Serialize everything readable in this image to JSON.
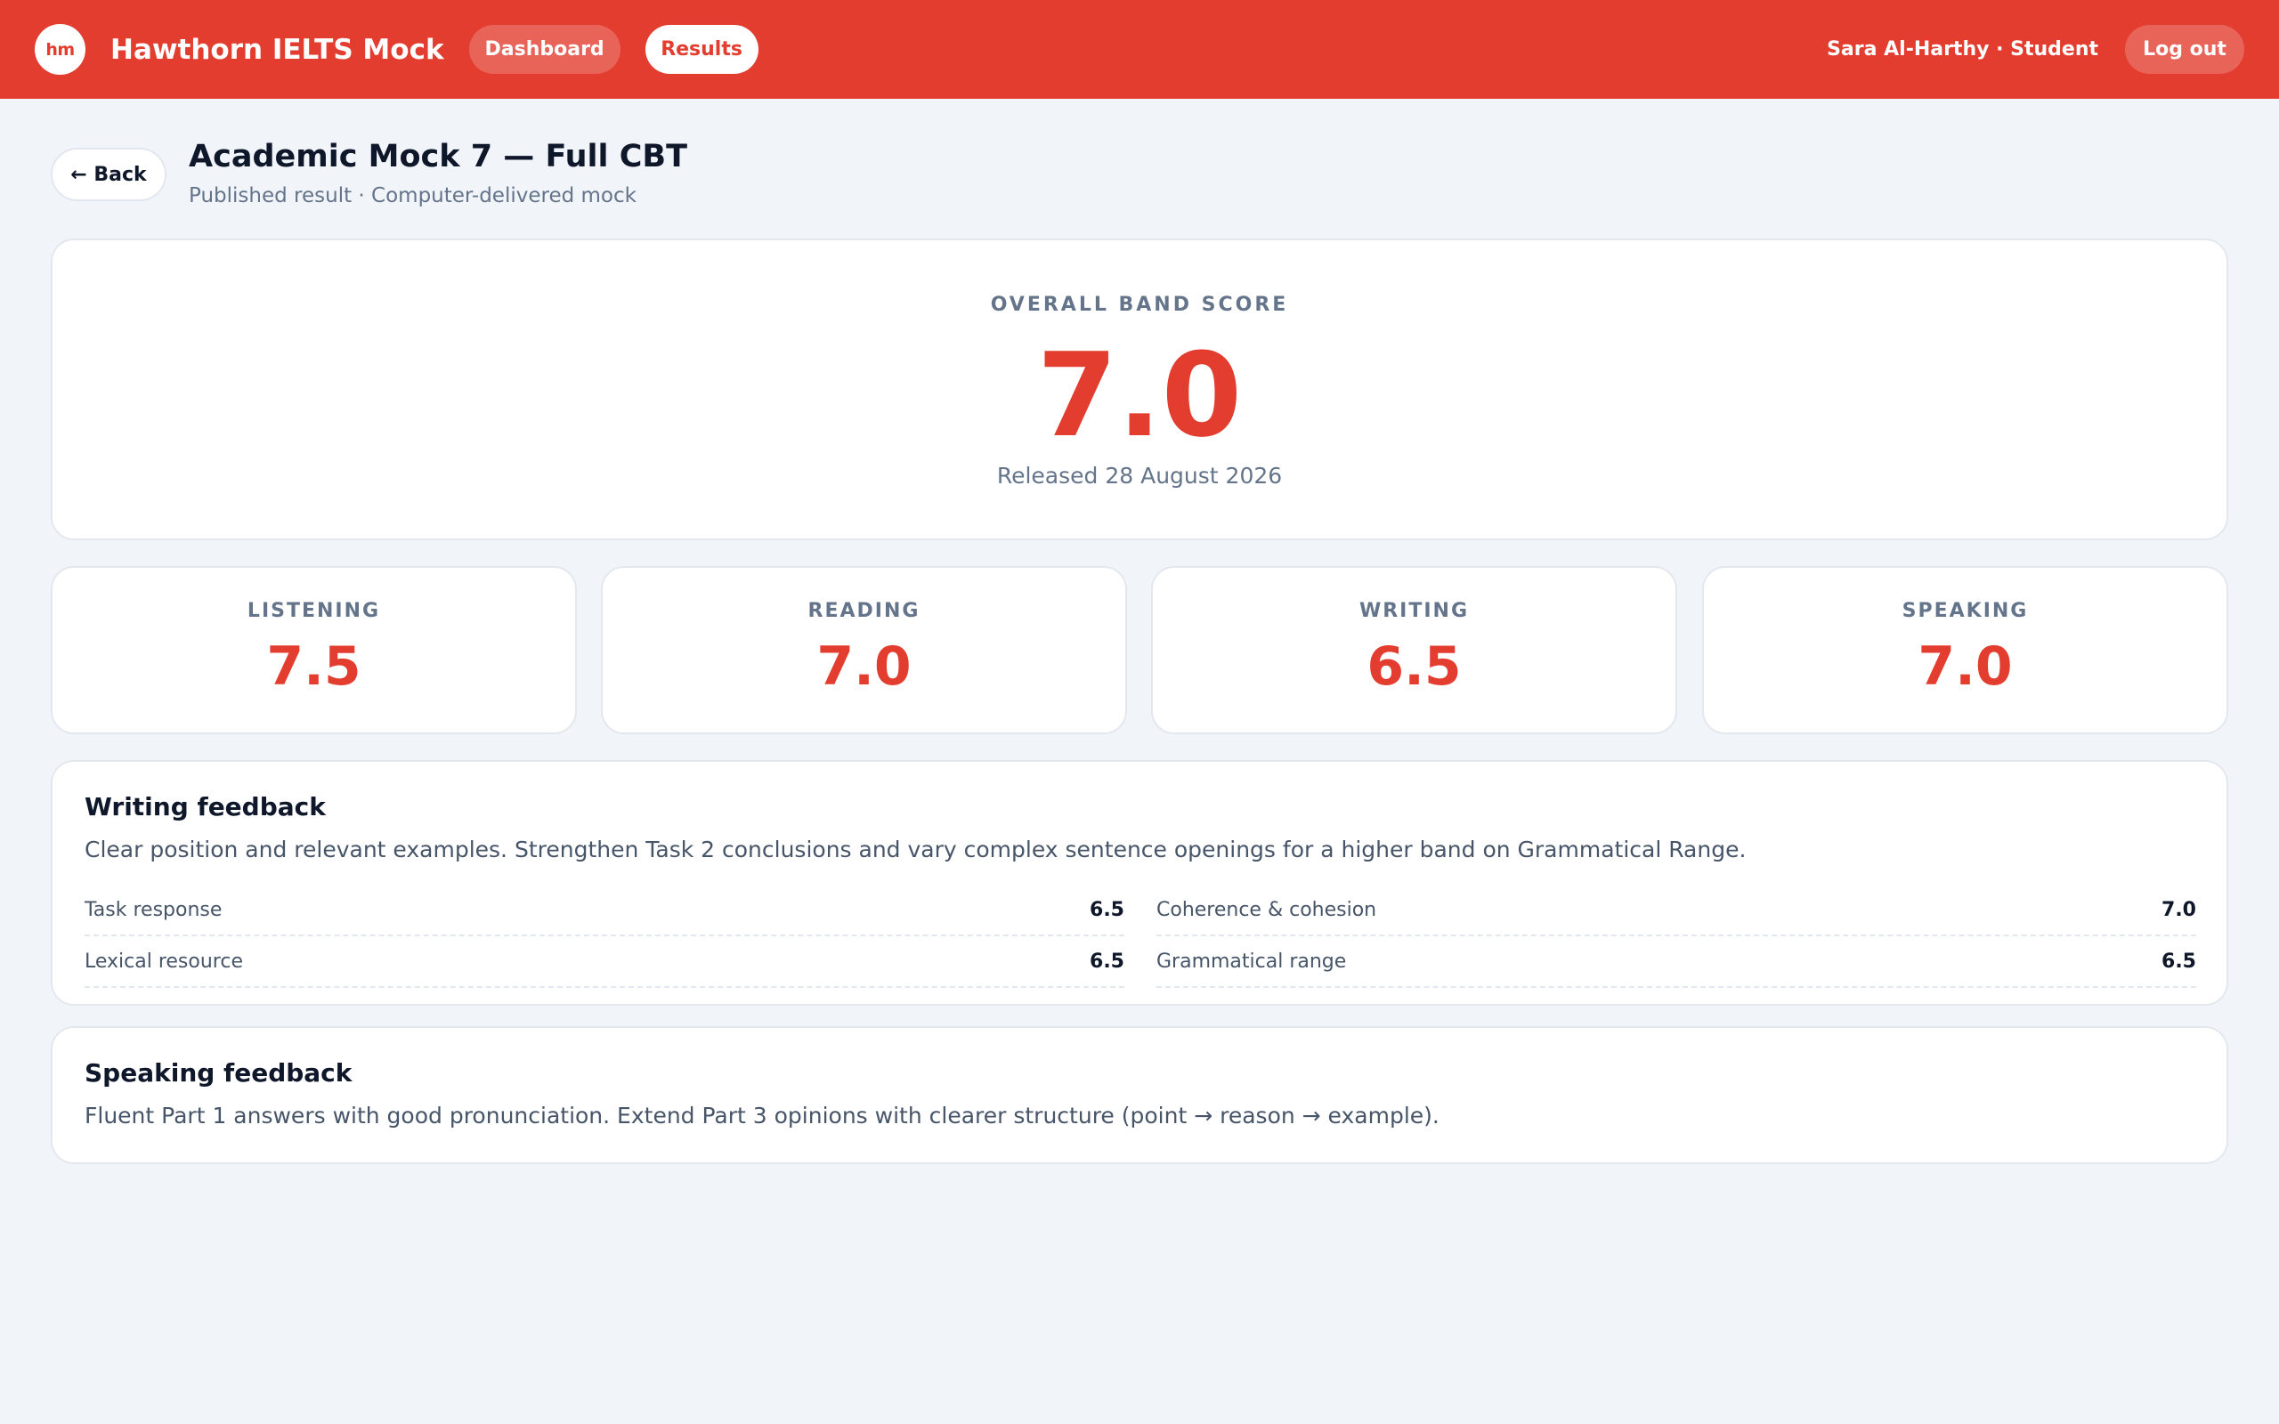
{
  "header": {
    "logo_text": "hm",
    "brand": "Hawthorn IELTS Mock",
    "nav": {
      "dashboard": "Dashboard",
      "results": "Results"
    },
    "user": "Sara Al-Harthy · Student",
    "logout": "Log out"
  },
  "page": {
    "back_label": "← Back",
    "title": "Academic Mock 7 — Full CBT",
    "subtitle": "Published result · Computer-delivered mock"
  },
  "overall": {
    "label": "OVERALL BAND SCORE",
    "score": "7.0",
    "released": "Released 28 August 2026"
  },
  "skills": [
    {
      "name": "LISTENING",
      "score": "7.5"
    },
    {
      "name": "READING",
      "score": "7.0"
    },
    {
      "name": "WRITING",
      "score": "6.5"
    },
    {
      "name": "SPEAKING",
      "score": "7.0"
    }
  ],
  "writing_feedback": {
    "title": "Writing feedback",
    "text": "Clear position and relevant examples. Strengthen Task 2 conclusions and vary complex sentence openings for a higher band on Grammatical Range.",
    "criteria": [
      {
        "label": "Task response",
        "score": "6.5"
      },
      {
        "label": "Coherence & cohesion",
        "score": "7.0"
      },
      {
        "label": "Lexical resource",
        "score": "6.5"
      },
      {
        "label": "Grammatical range",
        "score": "6.5"
      }
    ]
  },
  "speaking_feedback": {
    "title": "Speaking feedback",
    "text": "Fluent Part 1 answers with good pronunciation. Extend Part 3 opinions with clearer structure (point → reason → example)."
  },
  "colors": {
    "brand": "#e33d2f",
    "background": "#f1f4f8",
    "muted_text": "#64748b"
  }
}
